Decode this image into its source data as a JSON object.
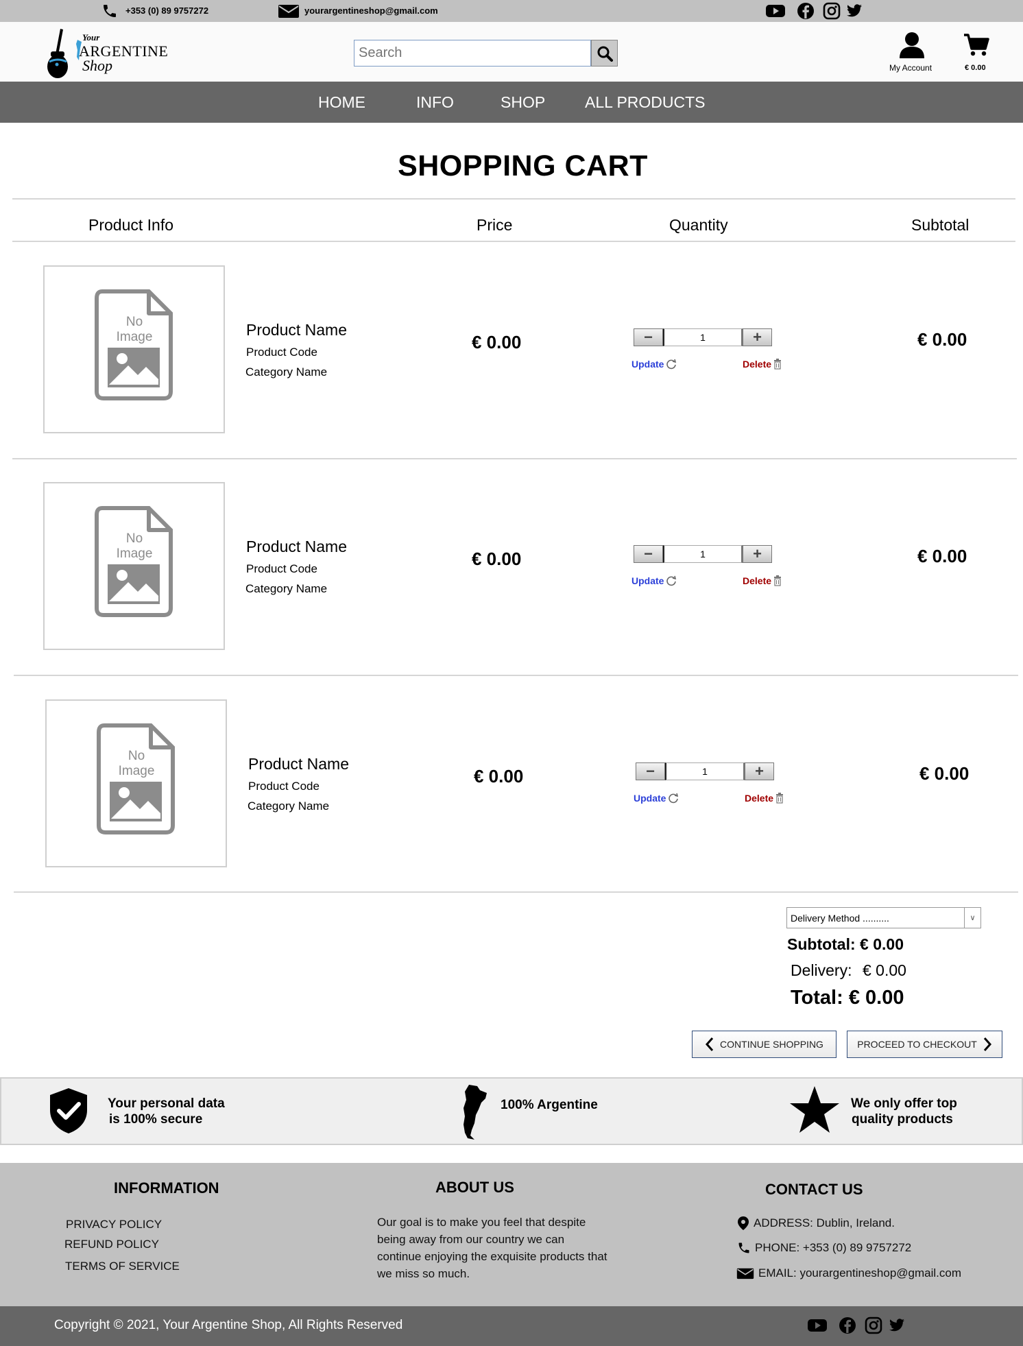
{
  "topbar": {
    "phone": "+353 (0) 89 9757272",
    "email": "yourargentineshop@gmail.com",
    "social_icons": [
      "youtube-icon",
      "facebook-icon",
      "instagram-icon",
      "twitter-icon"
    ]
  },
  "header": {
    "logo": {
      "line1": "Your",
      "line2": "ARGENTINE",
      "line3": "Shop"
    },
    "search_placeholder": "Search",
    "account_label": "My Account",
    "cart_total": "€ 0.00"
  },
  "nav": {
    "items": [
      "HOME",
      "INFO",
      "SHOP",
      "ALL PRODUCTS"
    ]
  },
  "cart": {
    "title": "SHOPPING CART",
    "columns": [
      "Product Info",
      "Price",
      "Quantity",
      "Subtotal"
    ],
    "items": [
      {
        "image_text_1": "No",
        "image_text_2": "Image",
        "name": "Product Name",
        "code": "Product Code",
        "category": "Category Name",
        "price": "€ 0.00",
        "quantity": "1",
        "update_label": "Update",
        "delete_label": "Delete",
        "subtotal": "€ 0.00"
      },
      {
        "image_text_1": "No",
        "image_text_2": "Image",
        "name": "Product Name",
        "code": "Product Code",
        "category": "Category Name",
        "price": "€ 0.00",
        "quantity": "1",
        "update_label": "Update",
        "delete_label": "Delete",
        "subtotal": "€ 0.00"
      },
      {
        "image_text_1": "No",
        "image_text_2": "Image",
        "name": "Product Name",
        "code": "Product Code",
        "category": "Category Name",
        "price": "€ 0.00",
        "quantity": "1",
        "update_label": "Update",
        "delete_label": "Delete",
        "subtotal": "€ 0.00"
      }
    ]
  },
  "summary": {
    "delivery_method": "Delivery Method ..........",
    "subtotal": "Subtotal: € 0.00",
    "delivery_label": "Delivery:",
    "delivery_value": "€ 0.00",
    "total": "Total: € 0.00",
    "continue_label": "CONTINUE SHOPPING",
    "checkout_label": "PROCEED TO CHECKOUT"
  },
  "trust": {
    "secure_line1": "Your personal data",
    "secure_line2": "is 100% secure",
    "argentine": "100% Argentine",
    "quality_line1": "We only offer top",
    "quality_line2": "quality products"
  },
  "footer": {
    "info_heading": "INFORMATION",
    "info_links": [
      "PRIVACY POLICY",
      "REFUND POLICY",
      "TERMS OF SERVICE"
    ],
    "about_heading": "ABOUT US",
    "about_text": "Our goal is to make you feel that despite being away from our country we can continue enjoying the exquisite products that we miss so much.",
    "contact_heading": "CONTACT US",
    "address": "ADDRESS: Dublin, Ireland.",
    "phone": "PHONE: +353 (0) 89 9757272",
    "email": "EMAIL: yourargentineshop@gmail.com",
    "copyright": "Copyright © 2021, Your Argentine Shop, All Rights Reserved"
  },
  "colors": {
    "topbar_bg": "#c1c1c1",
    "nav_bg": "#666666",
    "update_link": "#2b3fd8",
    "delete_link": "#a00000",
    "logo_accent": "#3a9fd6"
  }
}
